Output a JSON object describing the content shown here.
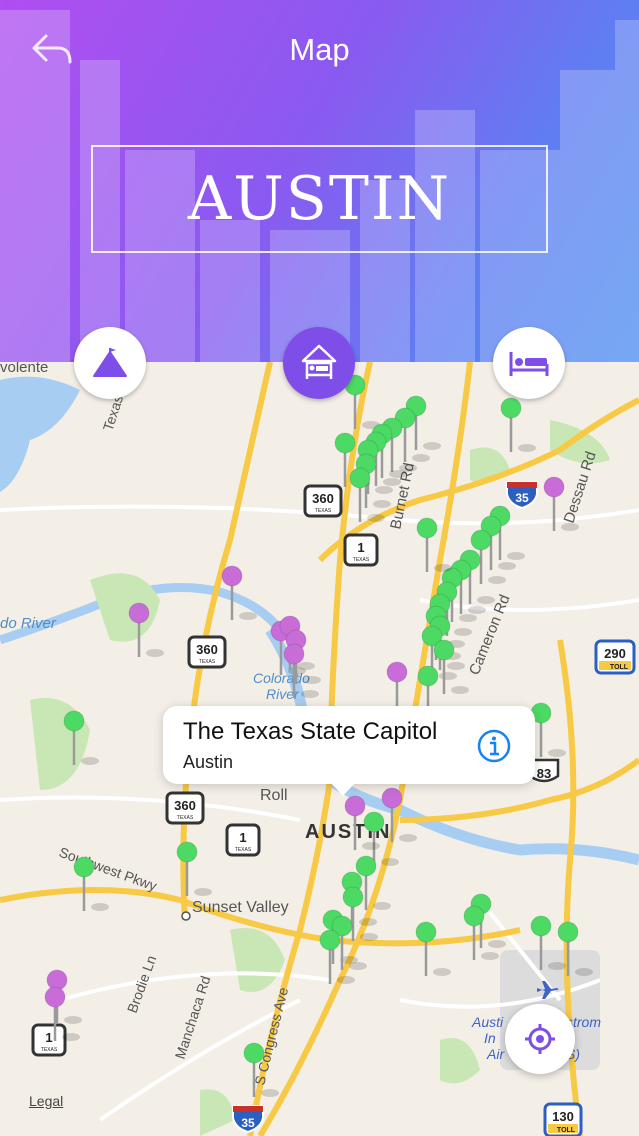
{
  "header": {
    "title": "Map",
    "city": "AUSTIN"
  },
  "categories": [
    {
      "name": "attractions",
      "icon": "circus-tent-icon",
      "active": false
    },
    {
      "name": "hotels",
      "icon": "hotel-tent-bed-icon",
      "active": true
    },
    {
      "name": "accommodation",
      "icon": "bed-icon",
      "active": false
    }
  ],
  "map": {
    "labels": {
      "volente": "volente",
      "texas": "Texas",
      "burnet_rd": "Burnet Rd",
      "dessau_rd": "Dessau Rd",
      "do_river": "do River",
      "colorado_river_1": "Colorado",
      "colorado_river_2": "River",
      "cameron_rd": "Cameron Rd",
      "rollingwood": "Roll",
      "southwest_pkwy": "Southwest Pkwy",
      "sunset_valley": "Sunset Valley",
      "brodie_ln": "Brodie Ln",
      "manchaca_rd": "Manchaca Rd",
      "s_congress_ave": "S Congress Ave",
      "austin": "AUSTIN",
      "airport_1": "Austi",
      "airport_2": "strom",
      "airport_3": "In",
      "airport_4": "Air",
      "airport_5": "S)"
    },
    "shields": {
      "hwy360": "360",
      "hwy1": "1",
      "texas_small": "TEXAS",
      "i35": "35",
      "us83": "83",
      "toll290": "290",
      "toll130": "130",
      "toll": "TOLL"
    },
    "callout": {
      "title": "The Texas State Capitol",
      "subtitle": "Austin"
    },
    "legal": "Legal"
  },
  "colors": {
    "pin_green": "#4cd964",
    "pin_purple": "#c86dd7",
    "accent": "#7f4ee8",
    "road_yellow": "#f7c944",
    "water": "#a7cdf2",
    "park": "#c9e7b4"
  }
}
